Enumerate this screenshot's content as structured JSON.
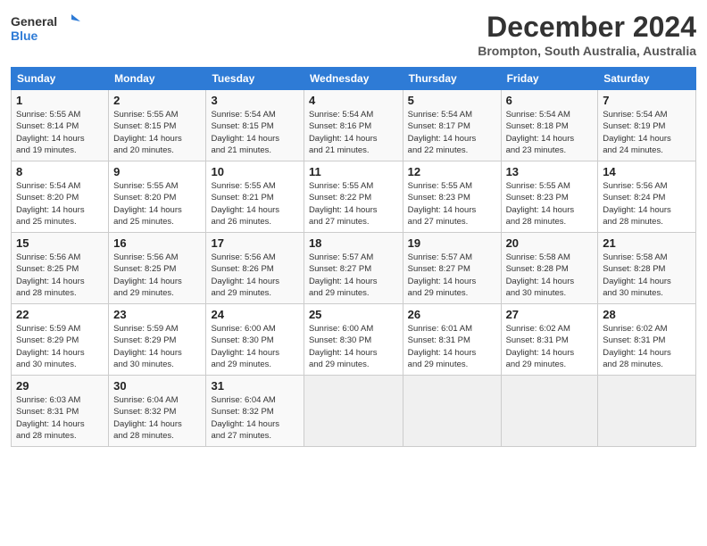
{
  "header": {
    "logo": {
      "general": "General",
      "blue": "Blue"
    },
    "title": "December 2024",
    "subtitle": "Brompton, South Australia, Australia"
  },
  "weekdays": [
    "Sunday",
    "Monday",
    "Tuesday",
    "Wednesday",
    "Thursday",
    "Friday",
    "Saturday"
  ],
  "weeks": [
    [
      {
        "day": "1",
        "info": "Sunrise: 5:55 AM\nSunset: 8:14 PM\nDaylight: 14 hours\nand 19 minutes."
      },
      {
        "day": "2",
        "info": "Sunrise: 5:55 AM\nSunset: 8:15 PM\nDaylight: 14 hours\nand 20 minutes."
      },
      {
        "day": "3",
        "info": "Sunrise: 5:54 AM\nSunset: 8:15 PM\nDaylight: 14 hours\nand 21 minutes."
      },
      {
        "day": "4",
        "info": "Sunrise: 5:54 AM\nSunset: 8:16 PM\nDaylight: 14 hours\nand 21 minutes."
      },
      {
        "day": "5",
        "info": "Sunrise: 5:54 AM\nSunset: 8:17 PM\nDaylight: 14 hours\nand 22 minutes."
      },
      {
        "day": "6",
        "info": "Sunrise: 5:54 AM\nSunset: 8:18 PM\nDaylight: 14 hours\nand 23 minutes."
      },
      {
        "day": "7",
        "info": "Sunrise: 5:54 AM\nSunset: 8:19 PM\nDaylight: 14 hours\nand 24 minutes."
      }
    ],
    [
      {
        "day": "8",
        "info": "Sunrise: 5:54 AM\nSunset: 8:20 PM\nDaylight: 14 hours\nand 25 minutes."
      },
      {
        "day": "9",
        "info": "Sunrise: 5:55 AM\nSunset: 8:20 PM\nDaylight: 14 hours\nand 25 minutes."
      },
      {
        "day": "10",
        "info": "Sunrise: 5:55 AM\nSunset: 8:21 PM\nDaylight: 14 hours\nand 26 minutes."
      },
      {
        "day": "11",
        "info": "Sunrise: 5:55 AM\nSunset: 8:22 PM\nDaylight: 14 hours\nand 27 minutes."
      },
      {
        "day": "12",
        "info": "Sunrise: 5:55 AM\nSunset: 8:23 PM\nDaylight: 14 hours\nand 27 minutes."
      },
      {
        "day": "13",
        "info": "Sunrise: 5:55 AM\nSunset: 8:23 PM\nDaylight: 14 hours\nand 28 minutes."
      },
      {
        "day": "14",
        "info": "Sunrise: 5:56 AM\nSunset: 8:24 PM\nDaylight: 14 hours\nand 28 minutes."
      }
    ],
    [
      {
        "day": "15",
        "info": "Sunrise: 5:56 AM\nSunset: 8:25 PM\nDaylight: 14 hours\nand 28 minutes."
      },
      {
        "day": "16",
        "info": "Sunrise: 5:56 AM\nSunset: 8:25 PM\nDaylight: 14 hours\nand 29 minutes."
      },
      {
        "day": "17",
        "info": "Sunrise: 5:56 AM\nSunset: 8:26 PM\nDaylight: 14 hours\nand 29 minutes."
      },
      {
        "day": "18",
        "info": "Sunrise: 5:57 AM\nSunset: 8:27 PM\nDaylight: 14 hours\nand 29 minutes."
      },
      {
        "day": "19",
        "info": "Sunrise: 5:57 AM\nSunset: 8:27 PM\nDaylight: 14 hours\nand 29 minutes."
      },
      {
        "day": "20",
        "info": "Sunrise: 5:58 AM\nSunset: 8:28 PM\nDaylight: 14 hours\nand 30 minutes."
      },
      {
        "day": "21",
        "info": "Sunrise: 5:58 AM\nSunset: 8:28 PM\nDaylight: 14 hours\nand 30 minutes."
      }
    ],
    [
      {
        "day": "22",
        "info": "Sunrise: 5:59 AM\nSunset: 8:29 PM\nDaylight: 14 hours\nand 30 minutes."
      },
      {
        "day": "23",
        "info": "Sunrise: 5:59 AM\nSunset: 8:29 PM\nDaylight: 14 hours\nand 30 minutes."
      },
      {
        "day": "24",
        "info": "Sunrise: 6:00 AM\nSunset: 8:30 PM\nDaylight: 14 hours\nand 29 minutes."
      },
      {
        "day": "25",
        "info": "Sunrise: 6:00 AM\nSunset: 8:30 PM\nDaylight: 14 hours\nand 29 minutes."
      },
      {
        "day": "26",
        "info": "Sunrise: 6:01 AM\nSunset: 8:31 PM\nDaylight: 14 hours\nand 29 minutes."
      },
      {
        "day": "27",
        "info": "Sunrise: 6:02 AM\nSunset: 8:31 PM\nDaylight: 14 hours\nand 29 minutes."
      },
      {
        "day": "28",
        "info": "Sunrise: 6:02 AM\nSunset: 8:31 PM\nDaylight: 14 hours\nand 28 minutes."
      }
    ],
    [
      {
        "day": "29",
        "info": "Sunrise: 6:03 AM\nSunset: 8:31 PM\nDaylight: 14 hours\nand 28 minutes."
      },
      {
        "day": "30",
        "info": "Sunrise: 6:04 AM\nSunset: 8:32 PM\nDaylight: 14 hours\nand 28 minutes."
      },
      {
        "day": "31",
        "info": "Sunrise: 6:04 AM\nSunset: 8:32 PM\nDaylight: 14 hours\nand 27 minutes."
      },
      {
        "day": "",
        "info": ""
      },
      {
        "day": "",
        "info": ""
      },
      {
        "day": "",
        "info": ""
      },
      {
        "day": "",
        "info": ""
      }
    ]
  ]
}
